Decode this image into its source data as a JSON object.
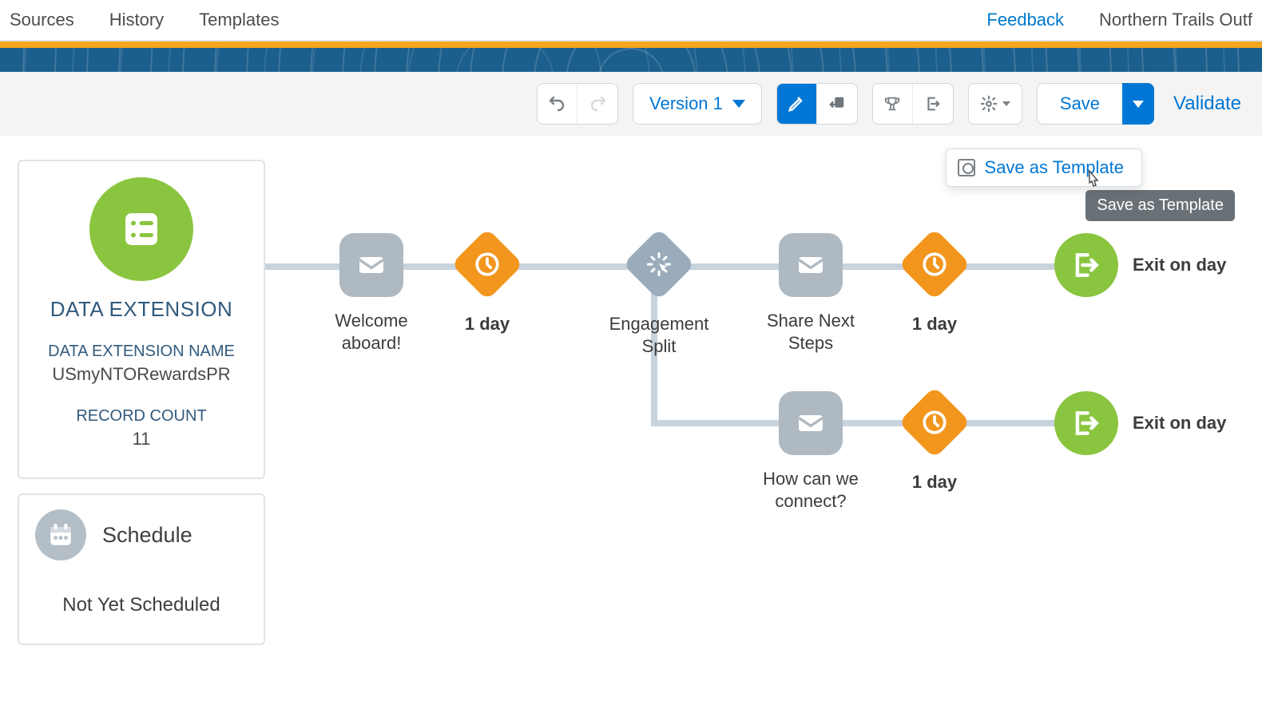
{
  "topnav": {
    "left": [
      "Sources",
      "History",
      "Templates"
    ],
    "feedback": "Feedback",
    "org": "Northern Trails Outf"
  },
  "toolbar": {
    "version": "Version 1",
    "save": "Save",
    "validate": "Validate",
    "menu_save_template": "Save as Template",
    "tooltip": "Save as Template"
  },
  "entry": {
    "title": "DATA EXTENSION",
    "name_label": "DATA EXTENSION NAME",
    "name_value": "USmyNTORewardsPR",
    "count_label": "RECORD COUNT",
    "count_value": "11"
  },
  "schedule": {
    "title": "Schedule",
    "status": "Not Yet Scheduled"
  },
  "nodes": {
    "welcome": "Welcome aboard!",
    "wait1": "1 day",
    "split": "Engagement Split",
    "share": "Share Next Steps",
    "wait2": "1 day",
    "exit1": "Exit on day",
    "how": "How can we connect?",
    "wait3": "1 day",
    "exit2": "Exit on day"
  }
}
